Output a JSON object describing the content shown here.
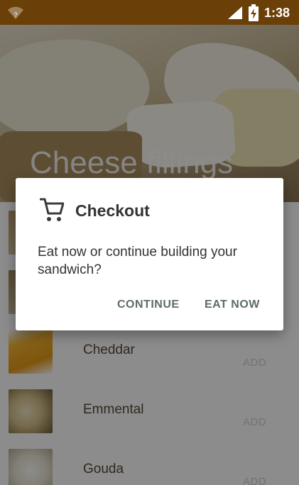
{
  "status_bar": {
    "time": "1:38",
    "wifi_icon": "wifi-unknown-icon",
    "signal_icon": "cell-signal-icon",
    "battery_icon": "battery-charging-icon"
  },
  "header": {
    "title": "Cheese fillings"
  },
  "list": {
    "items": [
      {
        "name": "",
        "action": ""
      },
      {
        "name": "",
        "action": ""
      },
      {
        "name": "Cheddar",
        "action": "ADD"
      },
      {
        "name": "Emmental",
        "action": "ADD"
      },
      {
        "name": "Gouda",
        "action": "ADD"
      }
    ]
  },
  "dialog": {
    "icon": "shopping-cart-icon",
    "title": "Checkout",
    "message": "Eat now or continue building your sandwich?",
    "continue_label": "CONTINUE",
    "eat_now_label": "EAT NOW"
  },
  "colors": {
    "status_bar": "#6b4008",
    "dialog_button_text": "#5e6b6b"
  }
}
